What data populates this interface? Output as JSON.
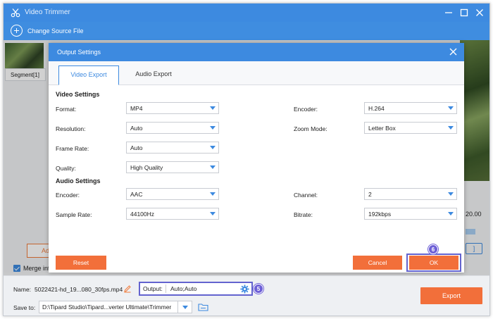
{
  "window": {
    "title": "Video Trimmer",
    "toolbar_label": "Change Source File"
  },
  "left_pane": {
    "segment_label": "Segment[1]",
    "add_button_label": "Ad",
    "merge_label": "Merge into one"
  },
  "right_pane": {
    "time": "20.00",
    "button_label": "]"
  },
  "footer": {
    "name_label": "Name:",
    "name_value": "5022421-hd_19...080_30fps.mp4",
    "output_label": "Output:",
    "output_value": "Auto;Auto",
    "save_label": "Save to:",
    "save_path": "D:\\Tipard Studio\\Tipard...verter Ultimate\\Trimmer",
    "export_label": "Export"
  },
  "dialog": {
    "title": "Output Settings",
    "tabs": [
      "Video Export",
      "Audio Export"
    ],
    "video_section": "Video Settings",
    "audio_section": "Audio Settings",
    "video_left": [
      {
        "label": "Format:",
        "value": "MP4"
      },
      {
        "label": "Resolution:",
        "value": "Auto"
      },
      {
        "label": "Frame Rate:",
        "value": "Auto"
      },
      {
        "label": "Quality:",
        "value": "High Quality"
      }
    ],
    "video_right": [
      {
        "label": "Encoder:",
        "value": "H.264"
      },
      {
        "label": "Zoom Mode:",
        "value": "Letter Box"
      }
    ],
    "audio_left": [
      {
        "label": "Encoder:",
        "value": "AAC"
      },
      {
        "label": "Sample Rate:",
        "value": "44100Hz"
      }
    ],
    "audio_right": [
      {
        "label": "Channel:",
        "value": "2"
      },
      {
        "label": "Bitrate:",
        "value": "192kbps"
      }
    ],
    "reset_label": "Reset",
    "cancel_label": "Cancel",
    "ok_label": "OK"
  },
  "steps": {
    "output_step": "5",
    "ok_step": "6"
  },
  "colors": {
    "accent_blue": "#3d8ae0",
    "action_orange": "#f26f3a",
    "highlight_purple": "#6363cf"
  }
}
